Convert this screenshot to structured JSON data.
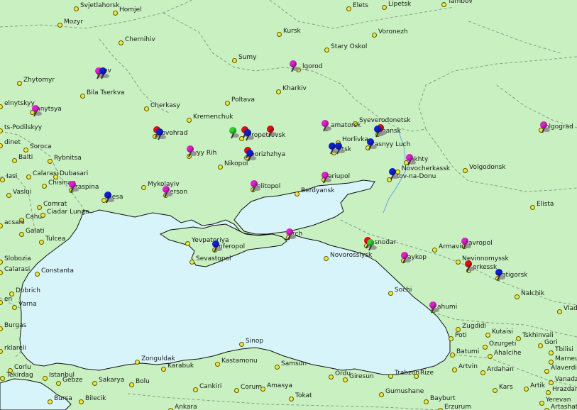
{
  "colors": {
    "land": "#c8f0c0",
    "sea": "#d8f4fb",
    "coast": "#111111",
    "border": "#8a9a8a",
    "pins": {
      "magenta": "#e020d0",
      "blue": "#1020d0",
      "red": "#e01010",
      "green": "#30d030"
    }
  },
  "cities": [
    {
      "name": "Svjetlahorsk"
    },
    {
      "name": "Homjel"
    },
    {
      "name": "Elets"
    },
    {
      "name": "Lipetsk"
    },
    {
      "name": "Tambov"
    },
    {
      "name": "Mozyr"
    },
    {
      "name": "Chernihiv"
    },
    {
      "name": "Kursk"
    },
    {
      "name": "Voronezh"
    },
    {
      "name": "Stary Oskol"
    },
    {
      "name": "Sumy"
    },
    {
      "name": "lgorod"
    },
    {
      "name": "Kharkiv"
    },
    {
      "name": "Zhytomyr"
    },
    {
      "name": "ev"
    },
    {
      "name": "Bila Tserkva"
    },
    {
      "name": "Poltava"
    },
    {
      "name": "elnytskyy"
    },
    {
      "name": "nnytsya"
    },
    {
      "name": "Cherkasy"
    },
    {
      "name": "Kremenchuk"
    },
    {
      "name": "Syeverodonetsk"
    },
    {
      "name": "amatorsk"
    },
    {
      "name": "hansk"
    },
    {
      "name": "olgograd"
    },
    {
      "name": "ts-Podilskyy"
    },
    {
      "name": "rovohrad"
    },
    {
      "name": "ipropetrovsk"
    },
    {
      "name": "Horlivka"
    },
    {
      "name": "rasnyy Luch"
    },
    {
      "name": "dinet"
    },
    {
      "name": "Soroca"
    },
    {
      "name": "vyy Rih"
    },
    {
      "name": "porizhzhya"
    },
    {
      "name": "etsk"
    },
    {
      "name": "akhty"
    },
    {
      "name": "Balti"
    },
    {
      "name": "Rybnitsa"
    },
    {
      "name": "Nikopol"
    },
    {
      "name": "Novocherkassk"
    },
    {
      "name": "Volgodonsk"
    },
    {
      "name": "Iasi"
    },
    {
      "name": "Calarasi"
    },
    {
      "name": "Dubasari"
    },
    {
      "name": "Chisinau"
    },
    {
      "name": "Mykolayiv"
    },
    {
      "name": "ariupol"
    },
    {
      "name": "stov-na-Donu"
    },
    {
      "name": "Vaslui"
    },
    {
      "name": "raspina"
    },
    {
      "name": "erson"
    },
    {
      "name": "elitopol"
    },
    {
      "name": "Berdyansk"
    },
    {
      "name": "Comrat"
    },
    {
      "name": "desa"
    },
    {
      "name": "Elista"
    },
    {
      "name": "Cahul"
    },
    {
      "name": "Ciadar Lunga"
    },
    {
      "name": "acsani"
    },
    {
      "name": "Galati"
    },
    {
      "name": "rch"
    },
    {
      "name": "Yevpatoriya"
    },
    {
      "name": "nferopol"
    },
    {
      "name": "asnodar"
    },
    {
      "name": "Armavir"
    },
    {
      "name": "avropol"
    },
    {
      "name": "Tulcea"
    },
    {
      "name": "Slobozia"
    },
    {
      "name": "Sevastopol"
    },
    {
      "name": "Novorossiysk"
    },
    {
      "name": "aykop"
    },
    {
      "name": "Nevinnomyssk"
    },
    {
      "name": "Calarasi"
    },
    {
      "name": "Constanta"
    },
    {
      "name": "erkessk"
    },
    {
      "name": "atigorsk"
    },
    {
      "name": "Dobrich"
    },
    {
      "name": "Sochi"
    },
    {
      "name": "Nalchik"
    },
    {
      "name": "Varna"
    },
    {
      "name": "en"
    },
    {
      "name": "Vladikav"
    },
    {
      "name": "ahumi"
    },
    {
      "name": "Burgas"
    },
    {
      "name": "Zugdidi"
    },
    {
      "name": "Tskhinvali"
    },
    {
      "name": "Kutaisi"
    },
    {
      "name": "Poti"
    },
    {
      "name": "Gori"
    },
    {
      "name": "Ozurgeti"
    },
    {
      "name": "Sinop"
    },
    {
      "name": "rklareli"
    },
    {
      "name": "Tbilisi"
    },
    {
      "name": "Batumi"
    },
    {
      "name": "Ahalcihe"
    },
    {
      "name": "Marneu"
    },
    {
      "name": "Zonguldak"
    },
    {
      "name": "Kastamonu"
    },
    {
      "name": "Samsun"
    },
    {
      "name": "Karabuk"
    },
    {
      "name": "Artvin"
    },
    {
      "name": "Ardahan"
    },
    {
      "name": "Alaverdi"
    },
    {
      "name": "Corlu"
    },
    {
      "name": "Tekirdag"
    },
    {
      "name": "Istanbul"
    },
    {
      "name": "Ordu"
    },
    {
      "name": "Giresun"
    },
    {
      "name": "Trabzon"
    },
    {
      "name": "Rize"
    },
    {
      "name": "Vanadzor"
    },
    {
      "name": "Gebze"
    },
    {
      "name": "Sakarya"
    },
    {
      "name": "Bolu"
    },
    {
      "name": "Cankiri"
    },
    {
      "name": "Corum"
    },
    {
      "name": "Amasya"
    },
    {
      "name": "Kars"
    },
    {
      "name": "Artik"
    },
    {
      "name": "Hrazdan"
    },
    {
      "name": "Gumushane"
    },
    {
      "name": "Tokat"
    },
    {
      "name": "Bayburt"
    },
    {
      "name": "Bursa"
    },
    {
      "name": "Bilecik"
    },
    {
      "name": "Ankara"
    },
    {
      "name": "Erzurum"
    },
    {
      "name": "Yerevan"
    },
    {
      "name": "Artashat"
    }
  ],
  "pins": [
    {
      "color": "magenta",
      "label": "Kyiv marker"
    },
    {
      "color": "blue",
      "label": "Kyiv marker"
    },
    {
      "color": "magenta",
      "label": "Belgorod marker"
    },
    {
      "color": "magenta",
      "label": "Vinnytsya marker"
    },
    {
      "color": "red",
      "label": "Kirovohrad marker"
    },
    {
      "color": "blue",
      "label": "Kirovohrad marker"
    },
    {
      "color": "green",
      "label": "Dnipro marker"
    },
    {
      "color": "red",
      "label": "Dnipro marker"
    },
    {
      "color": "blue",
      "label": "Dnipro marker"
    },
    {
      "color": "red",
      "label": "Dnipro marker"
    },
    {
      "color": "magenta",
      "label": "Kramatorsk marker"
    },
    {
      "color": "red",
      "label": "Luhansk marker"
    },
    {
      "color": "blue",
      "label": "Luhansk marker"
    },
    {
      "color": "magenta",
      "label": "Volgograd marker"
    },
    {
      "color": "blue",
      "label": "Krasnyy Luch marker"
    },
    {
      "color": "magenta",
      "label": "Kryvyy Rih marker"
    },
    {
      "color": "red",
      "label": "Zaporizhzhya marker"
    },
    {
      "color": "blue",
      "label": "Zaporizhzhya marker"
    },
    {
      "color": "blue",
      "label": "Donetsk marker"
    },
    {
      "color": "blue",
      "label": "Donetsk marker"
    },
    {
      "color": "magenta",
      "label": "Shakhty marker"
    },
    {
      "color": "blue",
      "label": "Rostov marker"
    },
    {
      "color": "magenta",
      "label": "Mariupol marker"
    },
    {
      "color": "magenta",
      "label": "Tiraspol marker"
    },
    {
      "color": "blue",
      "label": "Odesa marker"
    },
    {
      "color": "magenta",
      "label": "Kherson marker"
    },
    {
      "color": "magenta",
      "label": "Melitopol marker"
    },
    {
      "color": "magenta",
      "label": "Kerch marker"
    },
    {
      "color": "blue",
      "label": "Simferopol marker"
    },
    {
      "color": "red",
      "label": "Krasnodar marker"
    },
    {
      "color": "green",
      "label": "Krasnodar marker"
    },
    {
      "color": "magenta",
      "label": "Stavropol marker"
    },
    {
      "color": "magenta",
      "label": "Maykop marker"
    },
    {
      "color": "red",
      "label": "Cherkessk marker"
    },
    {
      "color": "blue",
      "label": "Pyatigorsk marker"
    },
    {
      "color": "magenta",
      "label": "Sukhumi marker"
    }
  ]
}
